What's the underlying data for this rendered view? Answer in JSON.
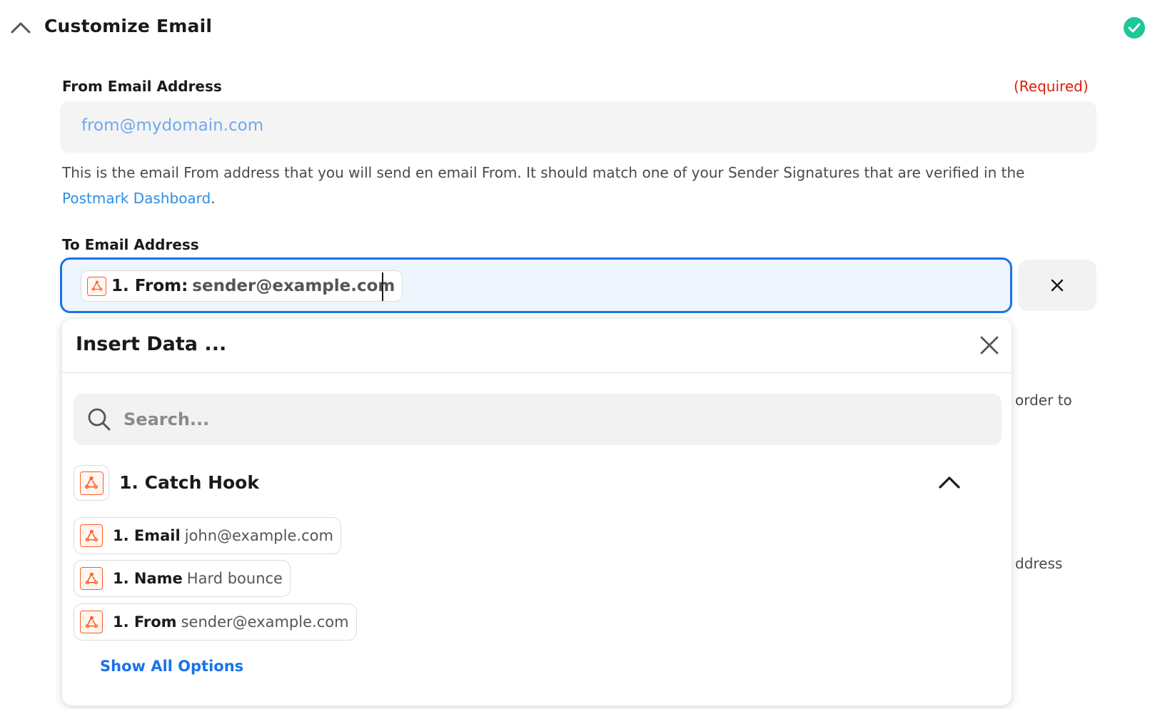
{
  "header": {
    "title": "Customize Email",
    "collapse_icon": "chevron-up-icon",
    "status_icon": "check-circle-icon",
    "status_color": "#1cc798"
  },
  "from_field": {
    "label": "From Email Address",
    "required": "(Required)",
    "placeholder": "from@mydomain.com",
    "help_text": "This is the email From address that you will send en email From. It should match one of your Sender Signatures that are verified in the",
    "help_link": "Postmark Dashboard",
    "help_suffix": "."
  },
  "to_field": {
    "label": "To Email Address",
    "token": {
      "icon": "webhook-icon",
      "key": "1. From:",
      "value": "sender@example.com"
    },
    "clear_icon": "close-icon"
  },
  "background_text": {
    "line1": "order to",
    "line2": "ddress"
  },
  "insert_data": {
    "title": "Insert Data ...",
    "close_icon": "close-icon",
    "search_placeholder": "Search...",
    "group": {
      "title": "1. Catch Hook",
      "icon": "webhook-icon",
      "expanded": true
    },
    "items": [
      {
        "key": "1. Email",
        "value": "john@example.com"
      },
      {
        "key": "1. Name",
        "value": "Hard bounce"
      },
      {
        "key": "1. From",
        "value": "sender@example.com"
      }
    ],
    "show_all": "Show All Options"
  },
  "colors": {
    "accent": "#1a73e8",
    "required": "#d9200c",
    "link": "#2f8ee6",
    "app_icon": "#ff5a1f"
  }
}
